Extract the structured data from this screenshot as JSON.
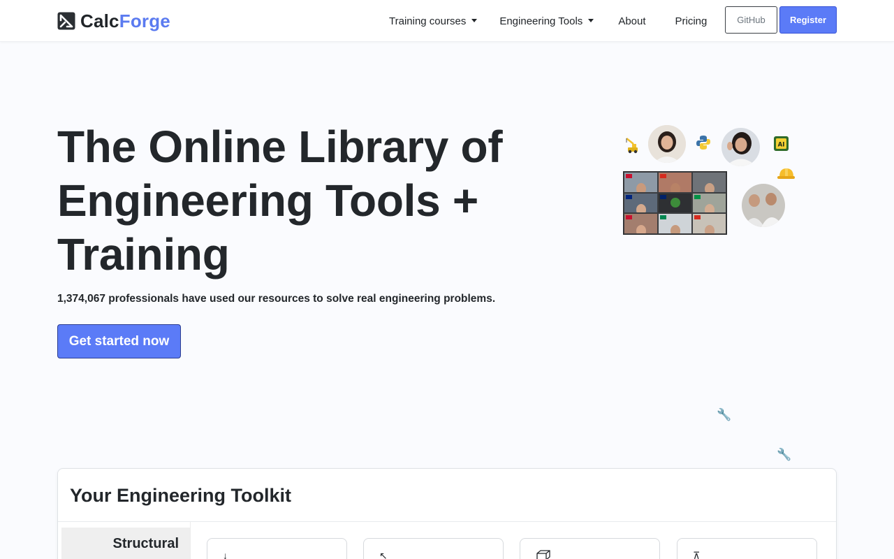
{
  "brand": {
    "name_part1": "Calc",
    "name_part2": "Forge",
    "color_dark": "#212529",
    "color_accent": "#5b7bf0"
  },
  "nav": {
    "items": [
      {
        "label": "Training courses",
        "dropdown": true
      },
      {
        "label": "Engineering Tools",
        "dropdown": true
      },
      {
        "label": "About",
        "dropdown": false
      },
      {
        "label": "Pricing",
        "dropdown": false
      }
    ],
    "github_label": "GitHub",
    "register_label": "Register"
  },
  "hero": {
    "title_line1": "The Online Library of",
    "title_line2": "Engineering Tools +",
    "title_line3": "Training",
    "subtitle": "1,374,067 professionals have used our resources to solve real engineering problems.",
    "cta_label": "Get started now",
    "collage_icons": [
      "crane-icon",
      "python-logo-icon",
      "ai-chip-icon",
      "hard-hat-icon",
      "wrench-icon",
      "wrench-icon"
    ]
  },
  "toolkit": {
    "title": "Your Engineering Toolkit",
    "active_category": "Structural",
    "tool_icons": [
      "arrow-down-icon",
      "cursor-arrow-icon",
      "cube-icon",
      "pulley-icon"
    ]
  },
  "colors": {
    "primary": "#5b7bf7",
    "primary_border": "#2d3e8f",
    "text": "#212529",
    "page_bg": "#fafbfe"
  }
}
